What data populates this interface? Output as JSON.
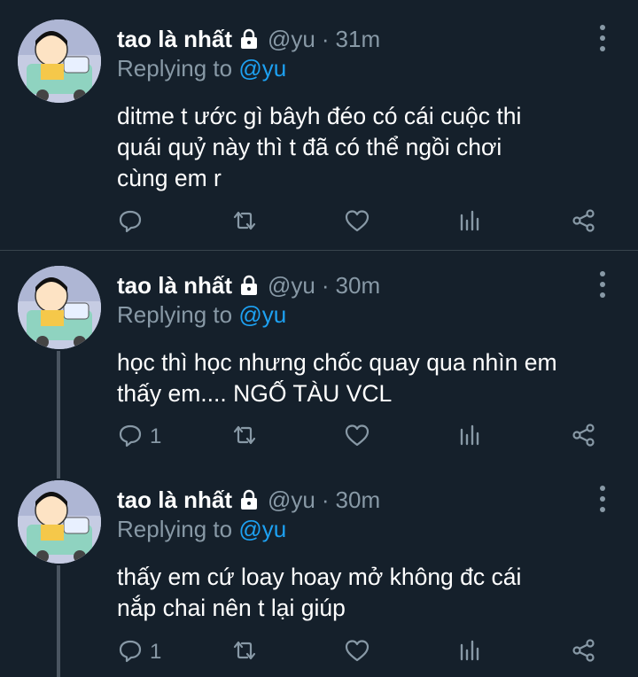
{
  "tweets": [
    {
      "name": "tao là nhất",
      "handle": "@yu",
      "dot": "·",
      "time": "31m",
      "replying_prefix": "Replying to",
      "replying_to": "@yu",
      "lines": [
        "ditme t ước gì bâyh đéo có cái cuộc thi",
        "quái quỷ này thì t đã có thể ngồi chơi",
        "cùng em r"
      ],
      "reply_count": "",
      "icons": [
        "reply-icon",
        "retweet-icon",
        "like-icon",
        "analytics-icon",
        "share-icon"
      ]
    },
    {
      "name": "tao là nhất",
      "handle": "@yu",
      "dot": "·",
      "time": "30m",
      "replying_prefix": "Replying to",
      "replying_to": "@yu",
      "lines": [
        "học thì học nhưng chốc quay qua nhìn em",
        "thấy em.... NGỐ TÀU VCL"
      ],
      "reply_count": "1",
      "icons": [
        "reply-icon",
        "retweet-icon",
        "like-icon",
        "analytics-icon",
        "share-icon"
      ]
    },
    {
      "name": "tao là nhất",
      "handle": "@yu",
      "dot": "·",
      "time": "30m",
      "replying_prefix": "Replying to",
      "replying_to": "@yu",
      "lines": [
        "thấy em cứ loay hoay mở không đc cái",
        "nắp chai nên t lại giúp"
      ],
      "reply_count": "1",
      "icons": [
        "reply-icon",
        "retweet-icon",
        "like-icon",
        "analytics-icon",
        "share-icon"
      ]
    }
  ],
  "colors": {
    "background": "#15202b",
    "secondary_text": "#8899a6",
    "link": "#1da1f2",
    "divider": "#38444d",
    "thread_line": "#4a5561"
  }
}
